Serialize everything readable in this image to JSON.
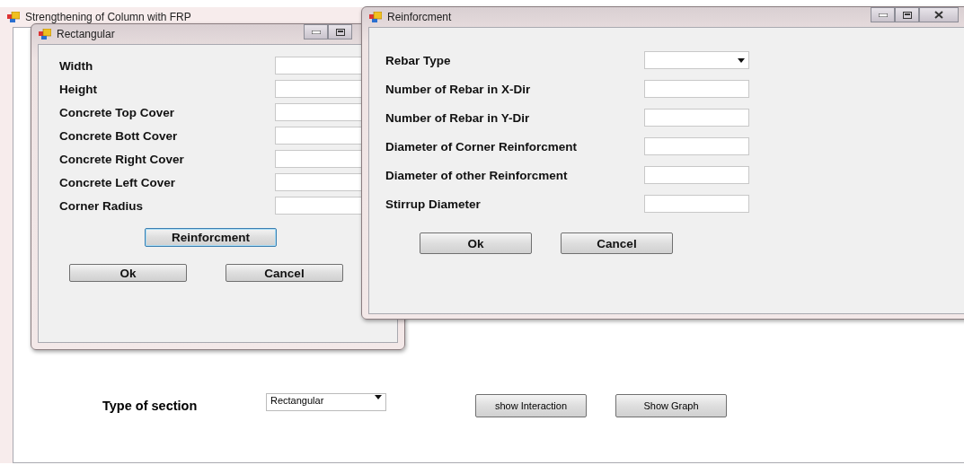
{
  "main_window": {
    "title": "Strengthening of Column with FRP",
    "section_label": "Type of section",
    "section_type": {
      "value": "Rectangular"
    },
    "buttons": [
      "show Interaction",
      "Show Graph"
    ]
  },
  "rectangular_dialog": {
    "title": "Rectangular",
    "fields": [
      {
        "label": "Width"
      },
      {
        "label": "Height"
      },
      {
        "label": "Concrete Top Cover"
      },
      {
        "label": "Concrete Bott Cover"
      },
      {
        "label": "Concrete Right Cover"
      },
      {
        "label": "Concrete Left Cover"
      },
      {
        "label": "Corner Radius"
      }
    ],
    "reinforcement_button": {
      "label": "Reinforcment",
      "focused": true
    },
    "buttons": [
      "Ok",
      "Cancel"
    ]
  },
  "reinforcement_dialog": {
    "title": "Reinforcment",
    "fields": [
      {
        "label": "Rebar Type",
        "kind": "dropdown"
      },
      {
        "label": "Number of Rebar in X-Dir",
        "kind": "text"
      },
      {
        "label": "Number of Rebar in Y-Dir",
        "kind": "text"
      },
      {
        "label": "Diameter of Corner Reinforcment",
        "kind": "text"
      },
      {
        "label": "Diameter of other Reinforcment",
        "kind": "text"
      },
      {
        "label": "Stirrup Diameter",
        "kind": "text"
      }
    ],
    "buttons": [
      "Ok",
      "Cancel"
    ]
  }
}
